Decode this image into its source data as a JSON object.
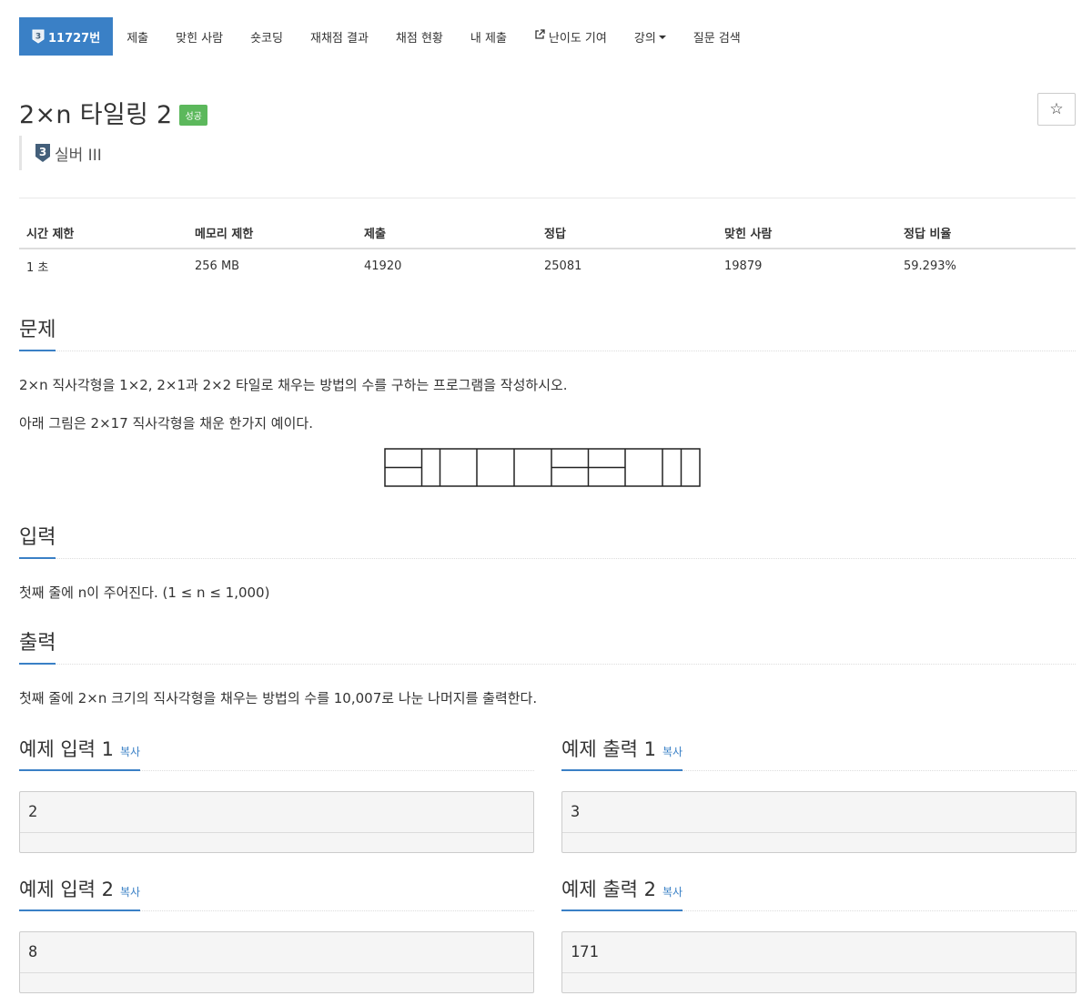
{
  "nav": {
    "tabs": [
      {
        "label": "11727번",
        "tier": "3"
      },
      {
        "label": "제출"
      },
      {
        "label": "맞힌 사람"
      },
      {
        "label": "숏코딩"
      },
      {
        "label": "재채점 결과"
      },
      {
        "label": "채점 현황"
      },
      {
        "label": "내 제출"
      },
      {
        "label": "난이도 기여"
      },
      {
        "label": "강의"
      },
      {
        "label": "질문 검색"
      }
    ]
  },
  "problem": {
    "title": "2×n 타일링 2",
    "status_label": "성공",
    "star_glyph": "☆",
    "tier_number": "3",
    "tier_text": "실버 III"
  },
  "stats": {
    "headers": [
      "시간 제한",
      "메모리 제한",
      "제출",
      "정답",
      "맞힌 사람",
      "정답 비율"
    ],
    "values": [
      "1 초",
      "256 MB",
      "41920",
      "25081",
      "19879",
      "59.293%"
    ]
  },
  "sections": {
    "problem_heading": "문제",
    "problem_text_1": "2×n 직사각형을 1×2, 2×1과 2×2 타일로 채우는 방법의 수를 구하는 프로그램을 작성하시오.",
    "problem_text_2": "아래 그림은 2×17 직사각형을 채운 한가지 예이다.",
    "input_heading": "입력",
    "input_text": "첫째 줄에 n이 주어진다. (1 ≤ n ≤ 1,000)",
    "output_heading": "출력",
    "output_text": "첫째 줄에 2×n 크기의 직사각형을 채우는 방법의 수를 10,007로 나눈 나머지를 출력한다."
  },
  "samples": {
    "copy_label": "복사",
    "in1_title": "예제 입력 1",
    "out1_title": "예제 출력 1",
    "in2_title": "예제 입력 2",
    "out2_title": "예제 출력 2",
    "in1_value": "2",
    "out1_value": "3",
    "in2_value": "8",
    "out2_value": "171"
  },
  "colors": {
    "accent": "#3a80c6",
    "success": "#5cb85c",
    "tier_silver": "#435f7a"
  }
}
